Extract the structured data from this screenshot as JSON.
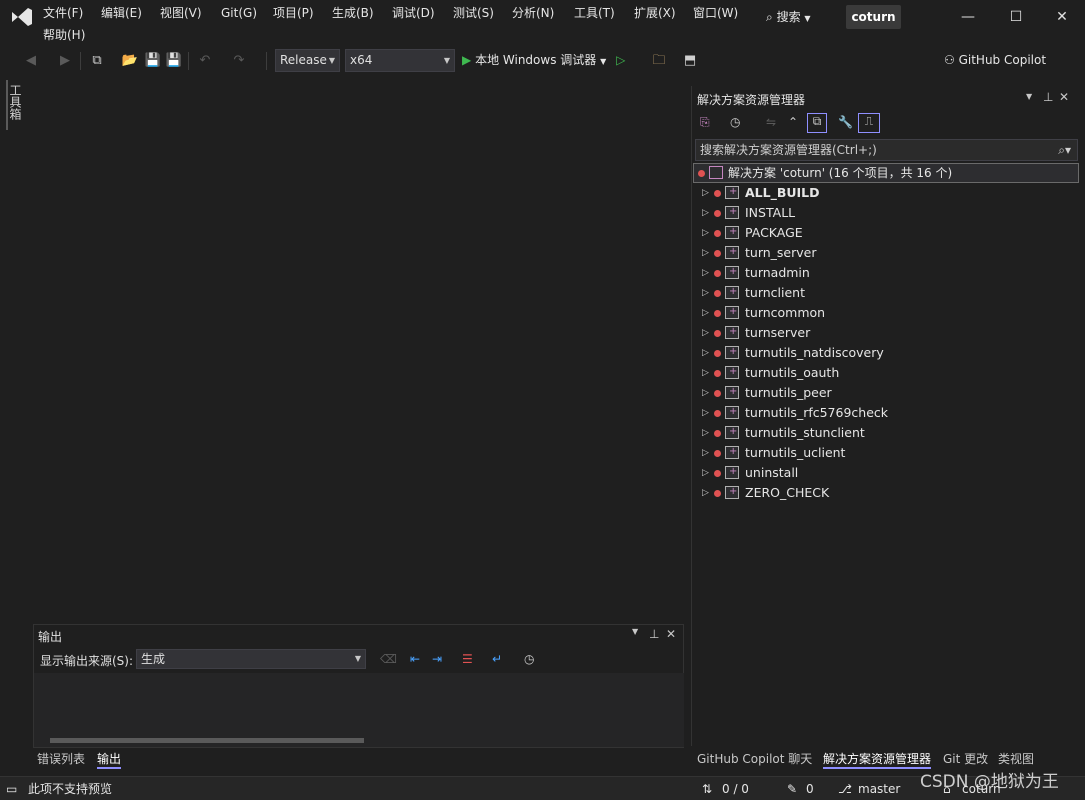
{
  "menu": {
    "items": [
      "文件(F)",
      "编辑(E)",
      "视图(V)",
      "Git(G)",
      "项目(P)",
      "生成(B)",
      "调试(D)",
      "测试(S)",
      "分析(N)",
      "工具(T)",
      "扩展(X)",
      "窗口(W)"
    ],
    "help": "帮助(H)",
    "search": "搜索",
    "project_name": "coturn"
  },
  "window_controls": {
    "minimize": "—",
    "maximize": "☐",
    "close": "✕"
  },
  "toolbar": {
    "config": "Release",
    "platform": "x64",
    "run_label": "本地 Windows 调试器",
    "copilot": "GitHub Copilot"
  },
  "toolbox_tab": "工具箱",
  "output": {
    "title": "输出",
    "source_label": "显示输出来源(S):",
    "source_value": "生成"
  },
  "bottom_left_tabs": [
    "错误列表",
    "输出"
  ],
  "bottom_right_tabs": [
    "GitHub Copilot 聊天",
    "解决方案资源管理器",
    "Git 更改",
    "类视图"
  ],
  "solution_explorer": {
    "title": "解决方案资源管理器",
    "search_placeholder": "搜索解决方案资源管理器(Ctrl+;)",
    "solution_label": "解决方案 'coturn' (16 个项目，共 16 个)",
    "projects": [
      "ALL_BUILD",
      "INSTALL",
      "PACKAGE",
      "turn_server",
      "turnadmin",
      "turnclient",
      "turncommon",
      "turnserver",
      "turnutils_natdiscovery",
      "turnutils_oauth",
      "turnutils_peer",
      "turnutils_rfc5769check",
      "turnutils_stunclient",
      "turnutils_uclient",
      "uninstall",
      "ZERO_CHECK"
    ]
  },
  "statusbar": {
    "preview": "此项不支持预览",
    "sync": "0 / 0",
    "pencil": "0",
    "branch": "master",
    "repo": "coturn",
    "watermark": "CSDN @地狱为王"
  },
  "colors": {
    "accent": "#8f8fff",
    "run_green": "#3fb950",
    "error_red": "#e05252",
    "bg": "#1f1f1f"
  }
}
